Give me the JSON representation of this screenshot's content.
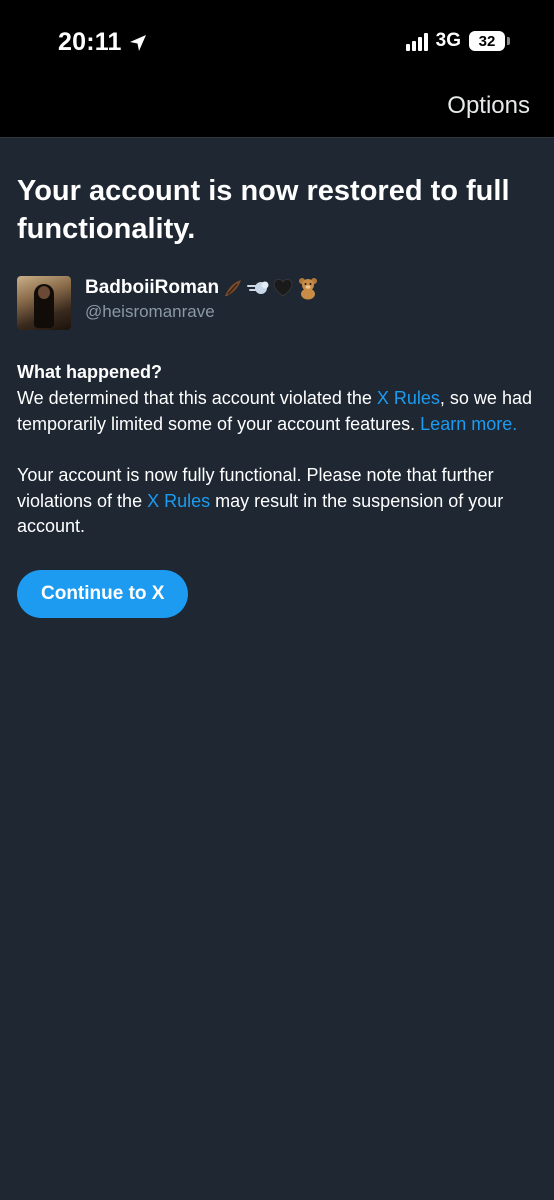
{
  "status_bar": {
    "time": "20:11",
    "network": "3G",
    "battery": "32"
  },
  "nav": {
    "options_label": "Options"
  },
  "main": {
    "title": "Your account is now restored to full functionality.",
    "user": {
      "display_name": "BadboiiRoman",
      "handle": "@heisromanrave"
    },
    "what_happened_heading": "What happened?",
    "para1": {
      "before": "We determined that this account violated the ",
      "link": "X Rules",
      "middle": ", so we had temporarily limited some of your account features. ",
      "learn_more": "Learn more."
    },
    "para2": {
      "before": "Your account is now fully functional. Please note that further violations of the ",
      "link": "X Rules",
      "after": " may result in the suspension of your account."
    },
    "continue_label": "Continue to X"
  },
  "colors": {
    "background": "#1e2732",
    "link": "#1d9bf0",
    "button": "#1d9bf0"
  }
}
